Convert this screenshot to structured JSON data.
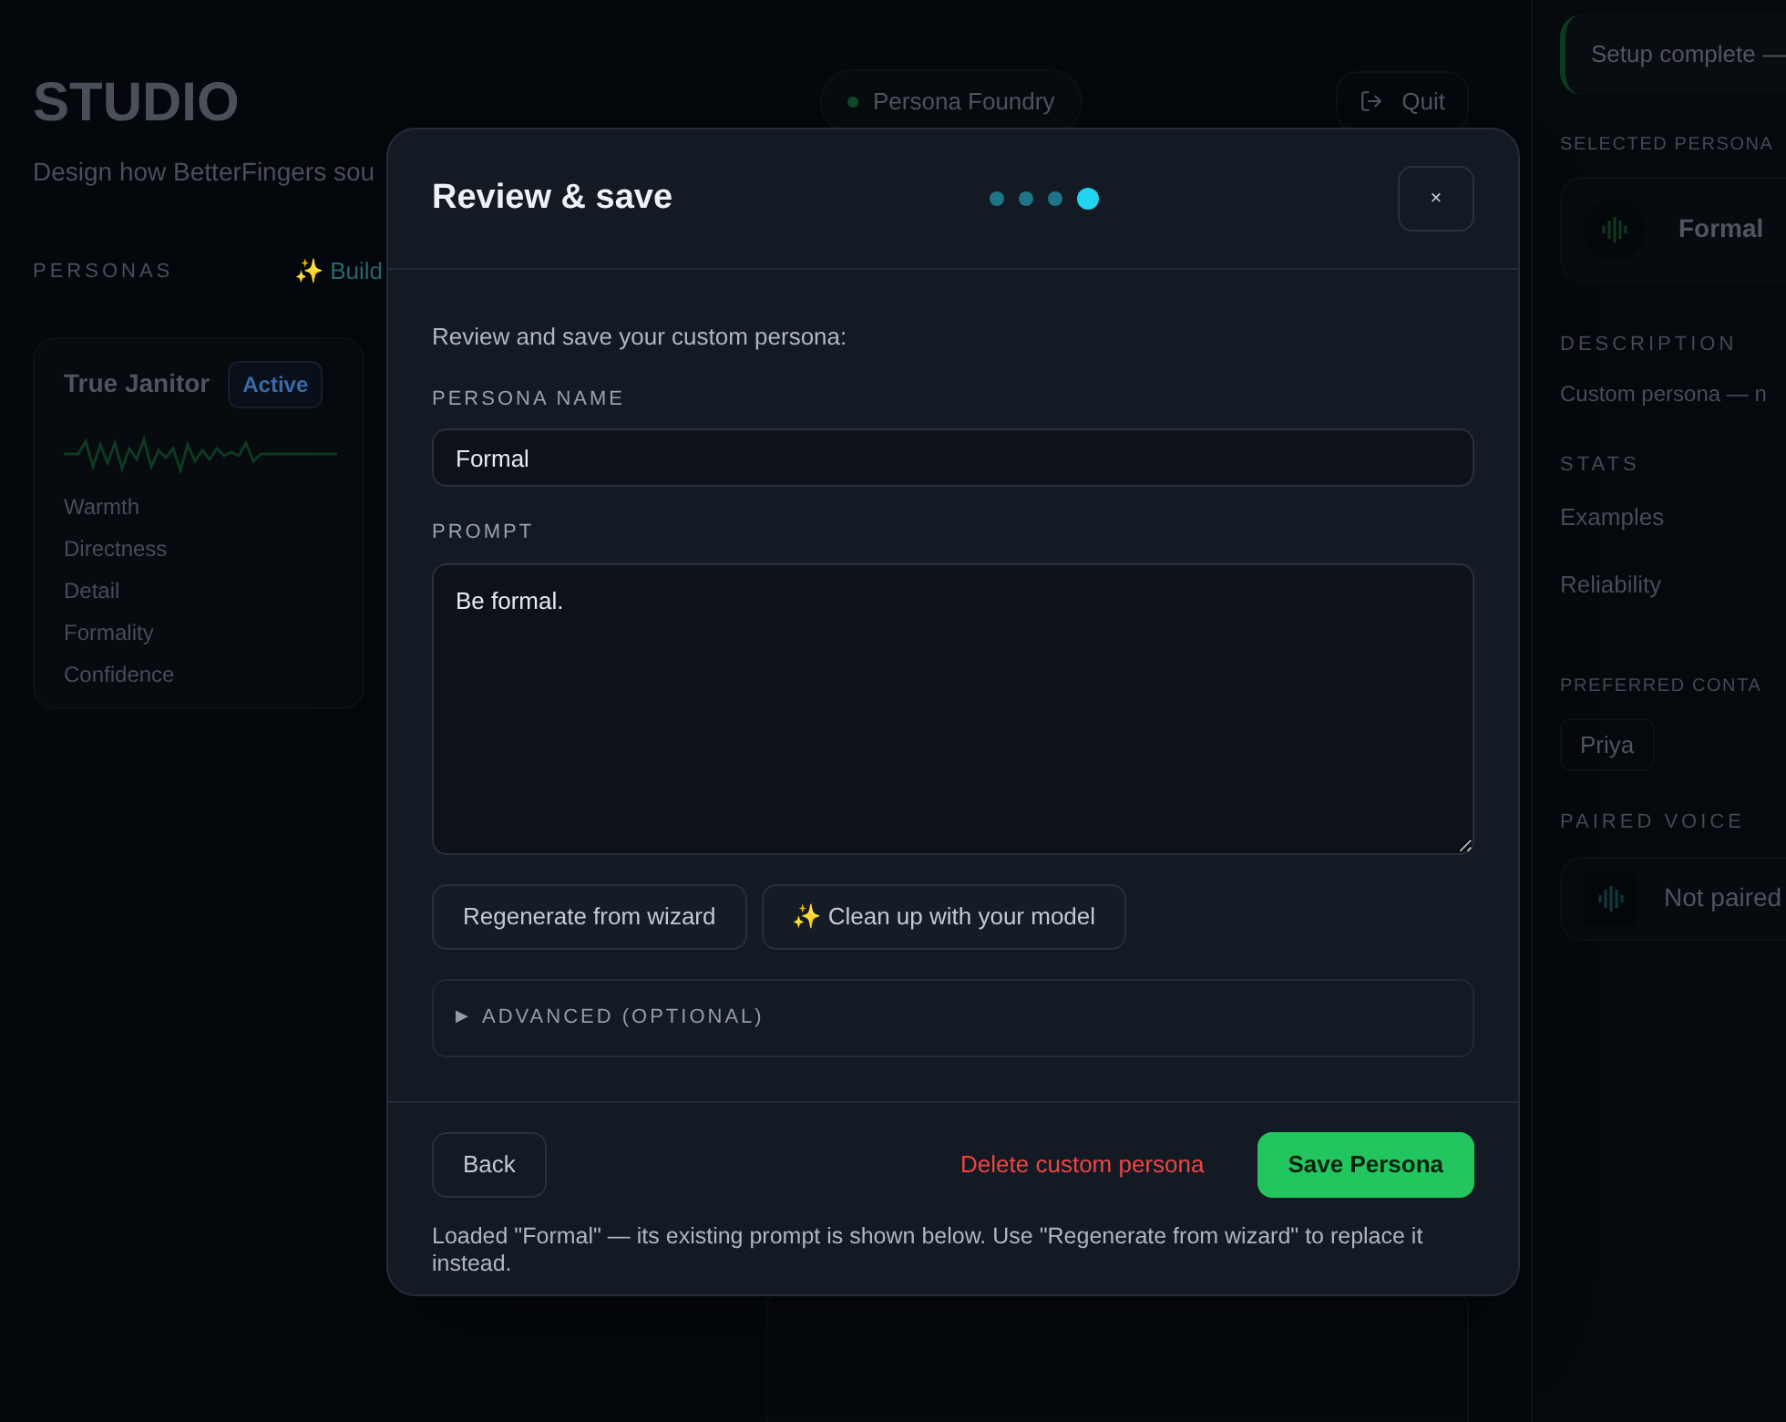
{
  "studio": {
    "title": "STUDIO",
    "subtitle": "Design how BetterFingers sou",
    "personas_label": "PERSONAS",
    "build_link": "✨ Build",
    "persona_card": {
      "name": "True Janitor",
      "badge": "Active",
      "traits": [
        "Warmth",
        "Directness",
        "Detail",
        "Formality",
        "Confidence"
      ]
    }
  },
  "header": {
    "app_badge": "Persona Foundry",
    "quit": "Quit"
  },
  "right_panel": {
    "toast": "Setup complete —",
    "selected_label": "SELECTED PERSONA",
    "selected_name": "Formal",
    "description_label": "DESCRIPTION",
    "description": "Custom persona — n",
    "stats_label": "STATS",
    "stats": [
      "Examples",
      "Reliability"
    ],
    "contact_label": "PREFERRED CONTA",
    "contact": "Priya",
    "voice_label": "PAIRED VOICE",
    "voice": "Not paired"
  },
  "modal": {
    "title": "Review & save",
    "steps": [
      {
        "selected": false
      },
      {
        "selected": false
      },
      {
        "selected": false
      },
      {
        "selected": true
      }
    ],
    "close": "×",
    "intro": "Review and save your custom persona:",
    "name_label": "PERSONA NAME",
    "name_value": "Formal",
    "prompt_label": "PROMPT",
    "prompt_value": "Be formal.",
    "actions": [
      "Regenerate from wizard",
      "✨ Clean up with your model"
    ],
    "advanced": {
      "label": "ADVANCED (OPTIONAL)",
      "marker": "▶",
      "expanded": false
    },
    "back": "Back",
    "delete": "Delete custom persona",
    "save": "Save Persona",
    "note": "Loaded \"Formal\" — its existing prompt is shown below. Use \"Regenerate from wizard\" to replace it instead."
  }
}
